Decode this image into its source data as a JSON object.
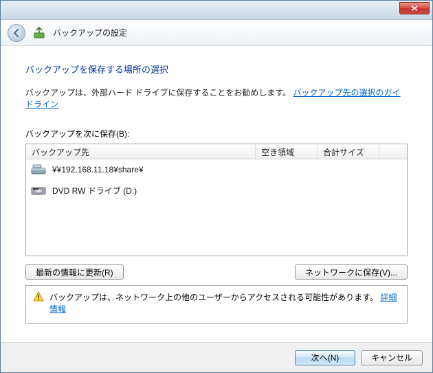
{
  "header": {
    "title": "バックアップの設定"
  },
  "main": {
    "heading": "バックアップを保存する場所の選択",
    "desc_prefix": "バックアップは、外部ハード ドライブに保存することをお勧めします。",
    "guideline_link": "バックアップ先の選択のガイドライン",
    "list_label": "バックアップを次に保存(B):",
    "columns": {
      "dest": "バックアップ先",
      "free": "空き領域",
      "total": "合計サイズ"
    },
    "rows": [
      {
        "icon": "network-drive",
        "text": "¥¥192.168.11.18¥share¥"
      },
      {
        "icon": "dvd-drive",
        "text": "DVD RW ドライブ (D:)"
      }
    ],
    "refresh_btn": "最新の情報に更新(R)",
    "network_btn": "ネットワークに保存(V)...",
    "warning_text": "バックアップは、ネットワーク上の他のユーザーからアクセスされる可能性があります。",
    "warning_link": "詳細情報"
  },
  "footer": {
    "next": "次へ(N)",
    "cancel": "キャンセル"
  }
}
